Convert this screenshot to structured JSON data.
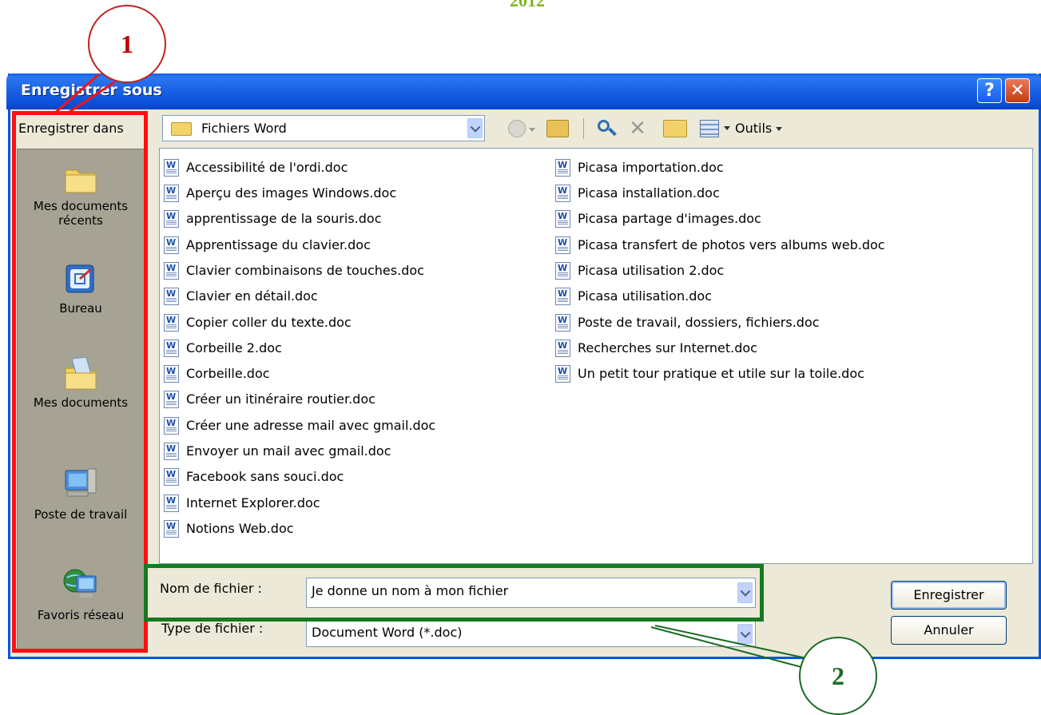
{
  "page": {
    "year": "2012"
  },
  "dialog": {
    "title": "Enregistrer sous"
  },
  "save_in": {
    "label": "Enregistrer dans",
    "folder": "Fichiers Word"
  },
  "toolbar": {
    "tools_label": "Outils"
  },
  "places": [
    {
      "line1": "Mes documents",
      "line2": "récents",
      "icon": "recent-documents-icon"
    },
    {
      "line1": "Bureau",
      "line2": "",
      "icon": "desktop-icon"
    },
    {
      "line1": "Mes documents",
      "line2": "",
      "icon": "my-documents-icon"
    },
    {
      "line1": "Poste de travail",
      "line2": "",
      "icon": "my-computer-icon"
    },
    {
      "line1": "Favoris réseau",
      "line2": "",
      "icon": "network-places-icon"
    }
  ],
  "files": [
    "Accessibilité de l'ordi.doc",
    "Aperçu des images Windows.doc",
    "apprentissage de la souris.doc",
    "Apprentissage du clavier.doc",
    "Clavier combinaisons de touches.doc",
    "Clavier en détail.doc",
    "Copier coller du texte.doc",
    "Corbeille 2.doc",
    "Corbeille.doc",
    "Créer un itinéraire routier.doc",
    "Créer une adresse mail avec gmail.doc",
    "Envoyer un  mail avec gmail.doc",
    "Facebook sans souci.doc",
    "Internet Explorer.doc",
    "Notions Web.doc",
    "Picasa importation.doc",
    "Picasa installation.doc",
    "Picasa partage d'images.doc",
    "Picasa transfert de photos vers albums web.doc",
    "Picasa utilisation 2.doc",
    "Picasa utilisation.doc",
    "Poste de travail, dossiers, fichiers.doc",
    "Recherches sur Internet.doc",
    "Un petit tour pratique et utile sur la toile.doc"
  ],
  "filename": {
    "label": "Nom de fichier :",
    "value": "Je donne un nom à mon fichier"
  },
  "filetype": {
    "label": "Type de fichier :",
    "value": "Document Word (*.doc)"
  },
  "buttons": {
    "save": "Enregistrer",
    "cancel": "Annuler"
  },
  "annotations": {
    "callout1": "1",
    "callout2": "2"
  },
  "colors": {
    "highlight_red": "#ff1010",
    "highlight_green": "#157a21",
    "titlebar": "#0a5fe8"
  }
}
